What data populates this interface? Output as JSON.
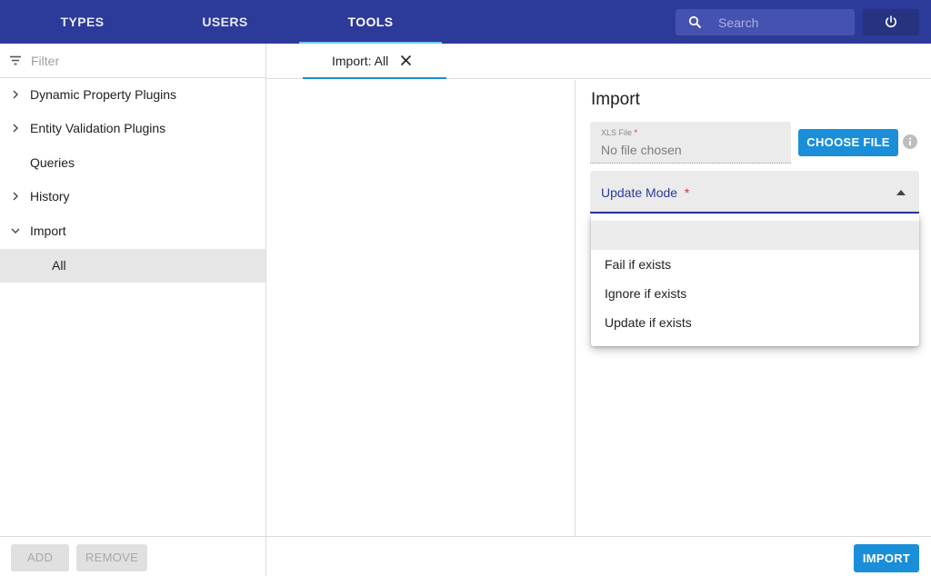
{
  "nav": {
    "tabs": [
      {
        "label": "TYPES"
      },
      {
        "label": "USERS"
      },
      {
        "label": "TOOLS",
        "active": true
      }
    ],
    "search_placeholder": "Search",
    "search_icon": "search-icon",
    "power_icon": "power-icon"
  },
  "sidebar": {
    "filter_placeholder": "Filter",
    "items": [
      {
        "label": "Dynamic Property Plugins",
        "expander": "collapsed"
      },
      {
        "label": "Entity Validation Plugins",
        "expander": "collapsed"
      },
      {
        "label": "Queries",
        "expander": "none"
      },
      {
        "label": "History",
        "expander": "collapsed"
      },
      {
        "label": "Import",
        "expander": "expanded"
      },
      {
        "label": "All",
        "expander": "none",
        "selected": true
      }
    ],
    "add_label": "ADD",
    "remove_label": "REMOVE"
  },
  "tabs": {
    "open": [
      {
        "label": "Import: All",
        "closable": true
      }
    ]
  },
  "import_panel": {
    "title": "Import",
    "file_label": "XLS File",
    "required_mark": "*",
    "file_value": "No file chosen",
    "choose_label": "CHOOSE FILE",
    "update_mode_label": "Update Mode",
    "options": [
      "",
      "Fail if exists",
      "Ignore if exists",
      "Update if exists"
    ],
    "import_label": "IMPORT"
  },
  "colors": {
    "topbar": "#2c3a9a",
    "primary_button": "#1a8ed9",
    "active_tab_indicator": "#6ec6ff",
    "required": "#d32f2f"
  }
}
